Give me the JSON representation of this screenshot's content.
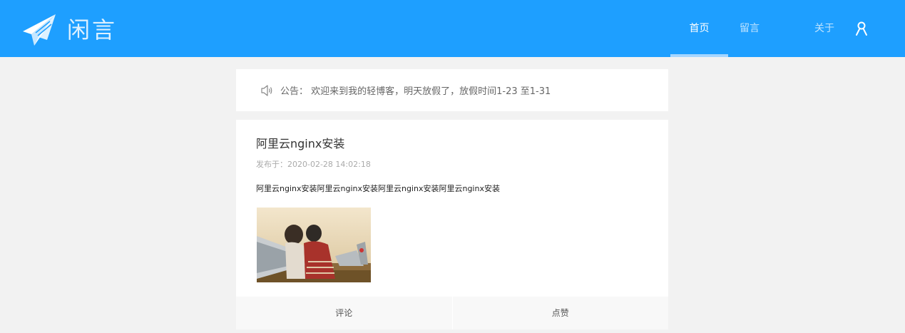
{
  "brand": {
    "title": "闲言",
    "icon": "paper-plane-icon"
  },
  "nav": {
    "items": [
      {
        "label": "首页",
        "active": true
      },
      {
        "label": "留言",
        "active": false
      },
      {
        "label": "关于",
        "active": false
      }
    ],
    "user_icon": "user-icon"
  },
  "notice": {
    "icon": "speaker-icon",
    "text": "公告：  欢迎来到我的轻博客，明天放假了，放假时间1-23 至1-31"
  },
  "article": {
    "title": "阿里云nginx安装",
    "date": "发布于：2020-02-28 14:02:18",
    "body": "阿里云nginx安装阿里云nginx安装阿里云nginx安装阿里云nginx安装",
    "image": "photo of two people beside aircraft",
    "actions": {
      "comment": "评论",
      "like": "点赞"
    }
  },
  "colors": {
    "header": "#1e9fff",
    "background": "#f2f2f2",
    "card": "#ffffff"
  }
}
